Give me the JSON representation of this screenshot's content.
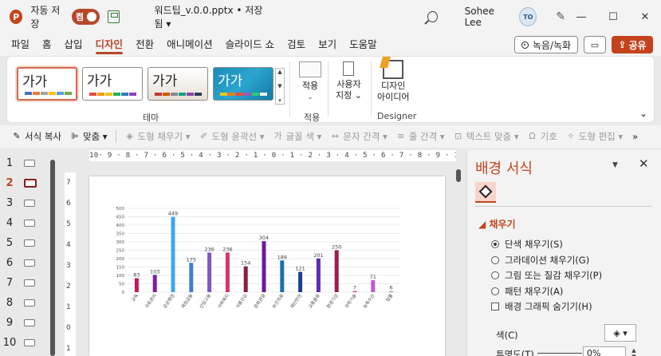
{
  "titlebar": {
    "logo": "P",
    "autosave_label": "자동 저장",
    "autosave_state": "켬",
    "doc_title": "워드팁_v.0.0.pptx • 저장됨 ▾",
    "user_name": "Sohee Lee",
    "avatar_text": "ТО",
    "icons": [
      "search-icon",
      "pen-icon",
      "minimize-icon",
      "maximize-icon",
      "close-icon"
    ],
    "minimize": "—",
    "maximize": "☐",
    "close": "✕"
  },
  "menu": {
    "items": [
      "파일",
      "홈",
      "삽입",
      "디자인",
      "전환",
      "애니메이션",
      "슬라이드 쇼",
      "검토",
      "보기",
      "도움말"
    ],
    "active_index": 3,
    "record_label": "녹음/녹화",
    "share_label": "공유",
    "accent_color": "#b7472a"
  },
  "ribbon": {
    "themes": [
      {
        "text": "가가"
      },
      {
        "text": "가가"
      },
      {
        "text": "가가"
      },
      {
        "text": "가가"
      }
    ],
    "theme_group_label": "테마",
    "size_label": "적용",
    "size_chevron": "⌄",
    "size_group_label": "적용",
    "format_label_1": "사용자",
    "format_label_2": "지정 ⌄",
    "designer_label_1": "디자인",
    "designer_label_2": "아이디어",
    "designer_group_label": "Designer",
    "collapse": "⌄"
  },
  "quick_toolbar": {
    "items": [
      {
        "label": "서식 복사",
        "icon": "brush-icon",
        "glyph": "✎",
        "enabled": true
      },
      {
        "label": "맞춤 ▾",
        "icon": "align-icon",
        "glyph": "⊫",
        "enabled": true
      },
      {
        "label": "도형 채우기 ▾",
        "icon": "fill-icon",
        "glyph": "◈",
        "enabled": false
      },
      {
        "label": "도형 윤곽선 ▾",
        "icon": "outline-icon",
        "glyph": "✐",
        "enabled": false
      },
      {
        "label": "글꼴 색 ▾",
        "icon": "font-color-icon",
        "glyph": "가",
        "enabled": false
      },
      {
        "label": "문자 간격 ▾",
        "icon": "char-spacing-icon",
        "glyph": "↔",
        "enabled": false
      },
      {
        "label": "줄 간격 ▾",
        "icon": "line-spacing-icon",
        "glyph": "≡",
        "enabled": false
      },
      {
        "label": "텍스트 맞춤 ▾",
        "icon": "text-align-icon",
        "glyph": "⊡",
        "enabled": false
      },
      {
        "label": "기호",
        "icon": "symbol-icon",
        "glyph": "Ω",
        "enabled": false
      },
      {
        "label": "도형 편집 ▾",
        "icon": "edit-shape-icon",
        "glyph": "✧",
        "enabled": false
      }
    ],
    "more": "»"
  },
  "slides": {
    "numbers": [
      "1",
      "2",
      "3",
      "4",
      "5",
      "6",
      "7",
      "8",
      "9",
      "10"
    ],
    "selected_index": 1
  },
  "ruler": {
    "horizontal": "10· 9 · 8 · 7 · 6 · 5 · 4 · 3 · 2 · 1 · 0 · 1 · 2 · 3 · 4 · 5 · 6 · 7 · 8 · 9 · 10",
    "vertical": [
      "7",
      "6",
      "5",
      "4",
      "3",
      "2",
      "1",
      "0",
      "1"
    ]
  },
  "chart_data": {
    "type": "bar",
    "categories": [
      "교육",
      "국토관리",
      "공공행정",
      "재정금융",
      "산업고용",
      "사회복지",
      "식품건강",
      "문화관광",
      "보건의료",
      "재난안전",
      "교통물류",
      "환경기상",
      "과학기술",
      "농축수산",
      "법률"
    ],
    "values": [
      83,
      103,
      449,
      175,
      236,
      236,
      154,
      304,
      189,
      121,
      201,
      250,
      7,
      71,
      6
    ],
    "colors": [
      "#c2185b",
      "#7b1fa2",
      "#42a5f5",
      "#3f7fd8",
      "#7e57c2",
      "#d6336c",
      "#8e1b3f",
      "#6a1b9a",
      "#1e6fa8",
      "#1e3f8a",
      "#5b2db3",
      "#9c1a4e",
      "#e64a7b",
      "#c158d8",
      "#999999"
    ],
    "ylim": [
      0,
      500
    ],
    "yticks": [
      0,
      50,
      100,
      150,
      200,
      250,
      300,
      350,
      400,
      450,
      500
    ],
    "grid": true,
    "xlabel": "",
    "ylabel": ""
  },
  "pane": {
    "title": "배경 서식",
    "down": "▼",
    "close": "✕",
    "section": "◢ 채우기",
    "options": [
      {
        "label": "단색 채우기(S)",
        "checked": true
      },
      {
        "label": "그라데이션 채우기(G)",
        "checked": false
      },
      {
        "label": "그림 또는 질감 채우기(P)",
        "checked": false
      },
      {
        "label": "패턴 채우기(A)",
        "checked": false
      }
    ],
    "hide_graphics": "배경 그래픽 숨기기(H)",
    "color_label": "색(C)",
    "color_btn": "◈ ▾",
    "transparency_label": "투명도(T)",
    "transparency_value": "0%"
  }
}
